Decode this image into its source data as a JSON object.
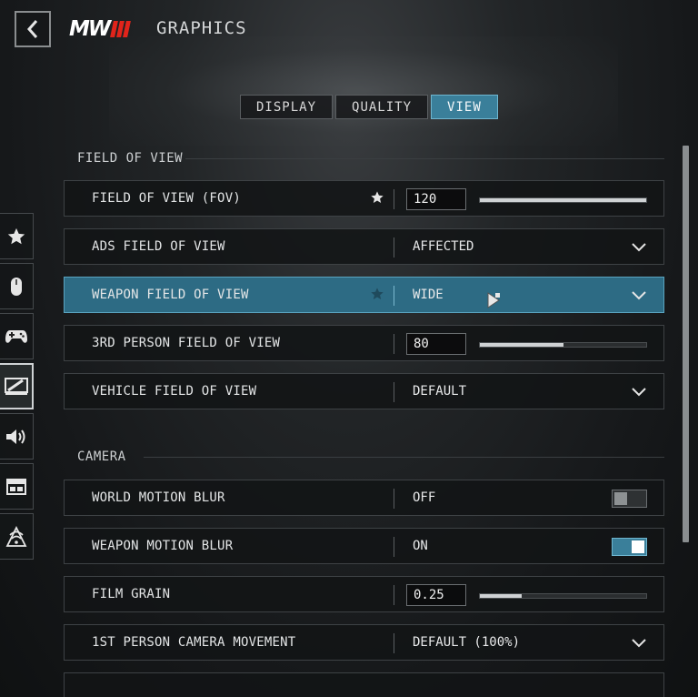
{
  "header": {
    "logo_text": "MW",
    "title": "GRAPHICS"
  },
  "tabs": [
    {
      "label": "DISPLAY",
      "active": false
    },
    {
      "label": "QUALITY",
      "active": false
    },
    {
      "label": "VIEW",
      "active": true
    }
  ],
  "rail": [
    {
      "icon": "star-icon"
    },
    {
      "icon": "mouse-icon"
    },
    {
      "icon": "gamepad-icon"
    },
    {
      "icon": "display-icon",
      "active": true
    },
    {
      "icon": "speaker-icon"
    },
    {
      "icon": "interface-icon"
    },
    {
      "icon": "network-icon"
    }
  ],
  "sections": {
    "fov": {
      "title": "FIELD OF VIEW",
      "rows": {
        "fov": {
          "label": "FIELD OF VIEW (FOV)",
          "value": "120",
          "fill": 1.0,
          "favorite": true
        },
        "ads_fov": {
          "label": "ADS FIELD OF VIEW",
          "value": "AFFECTED"
        },
        "weapon_fov": {
          "label": "WEAPON FIELD OF VIEW",
          "value": "WIDE",
          "selected": true
        },
        "third_person_fov": {
          "label": "3RD PERSON FIELD OF VIEW",
          "value": "80",
          "fill": 0.5
        },
        "vehicle_fov": {
          "label": "VEHICLE FIELD OF VIEW",
          "value": "DEFAULT"
        }
      }
    },
    "camera": {
      "title": "CAMERA",
      "rows": {
        "world_motion_blur": {
          "label": "WORLD MOTION BLUR",
          "value": "OFF",
          "on": false
        },
        "weapon_motion_blur": {
          "label": "WEAPON MOTION BLUR",
          "value": "ON",
          "on": true
        },
        "film_grain": {
          "label": "FILM GRAIN",
          "value": "0.25",
          "fill": 0.25
        },
        "camera_movement": {
          "label": "1ST PERSON CAMERA MOVEMENT",
          "value": "DEFAULT (100%)"
        }
      }
    }
  },
  "colors": {
    "accent": "#3a7f9a",
    "selected_row": "#2d6b84",
    "logo_red": "#e0241b"
  }
}
